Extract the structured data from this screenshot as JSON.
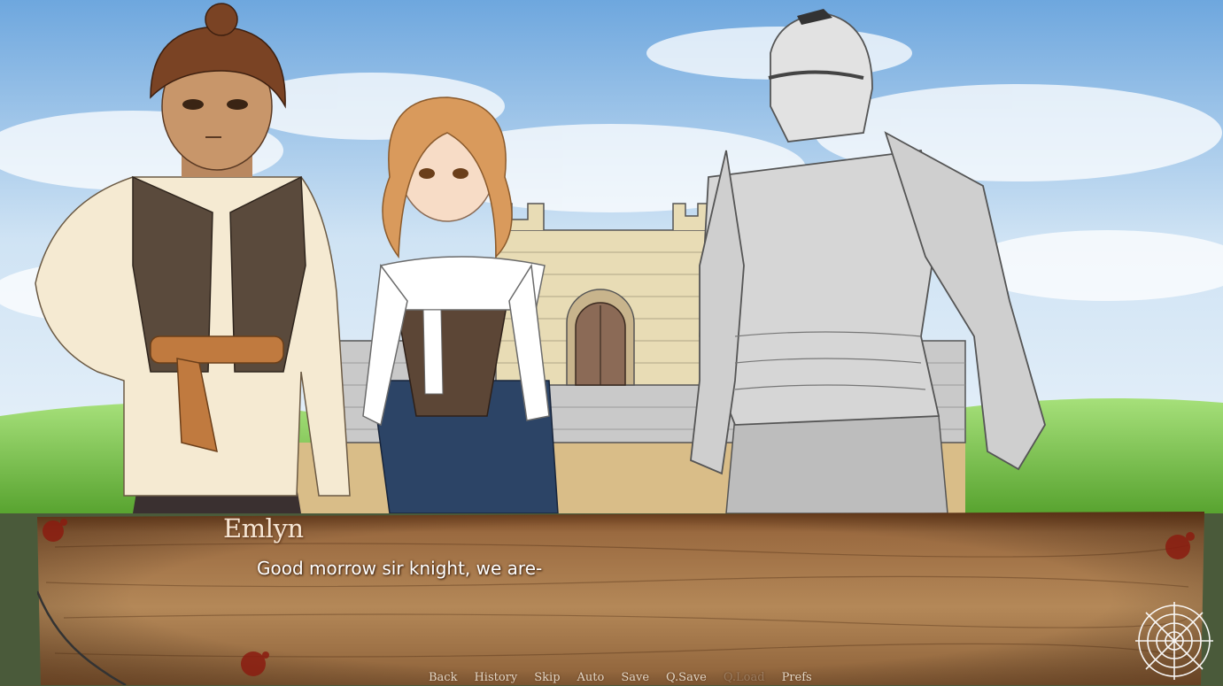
{
  "game": {
    "speaker": "Emlyn",
    "dialogue": "Good morrow sir knight, we are-"
  },
  "quick_menu": [
    {
      "label": "Back",
      "enabled": true
    },
    {
      "label": "History",
      "enabled": true
    },
    {
      "label": "Skip",
      "enabled": true
    },
    {
      "label": "Auto",
      "enabled": true
    },
    {
      "label": "Save",
      "enabled": true
    },
    {
      "label": "Q.Save",
      "enabled": true
    },
    {
      "label": "Q.Load",
      "enabled": false
    },
    {
      "label": "Prefs",
      "enabled": true
    }
  ],
  "colors": {
    "sky": "#9cc3e6",
    "grass": "#6fbf3a",
    "wood": "#8a5a34",
    "blood": "#8b1c10",
    "speaker_text": "#f6e6d4",
    "dialogue_text": "#ffffff"
  }
}
